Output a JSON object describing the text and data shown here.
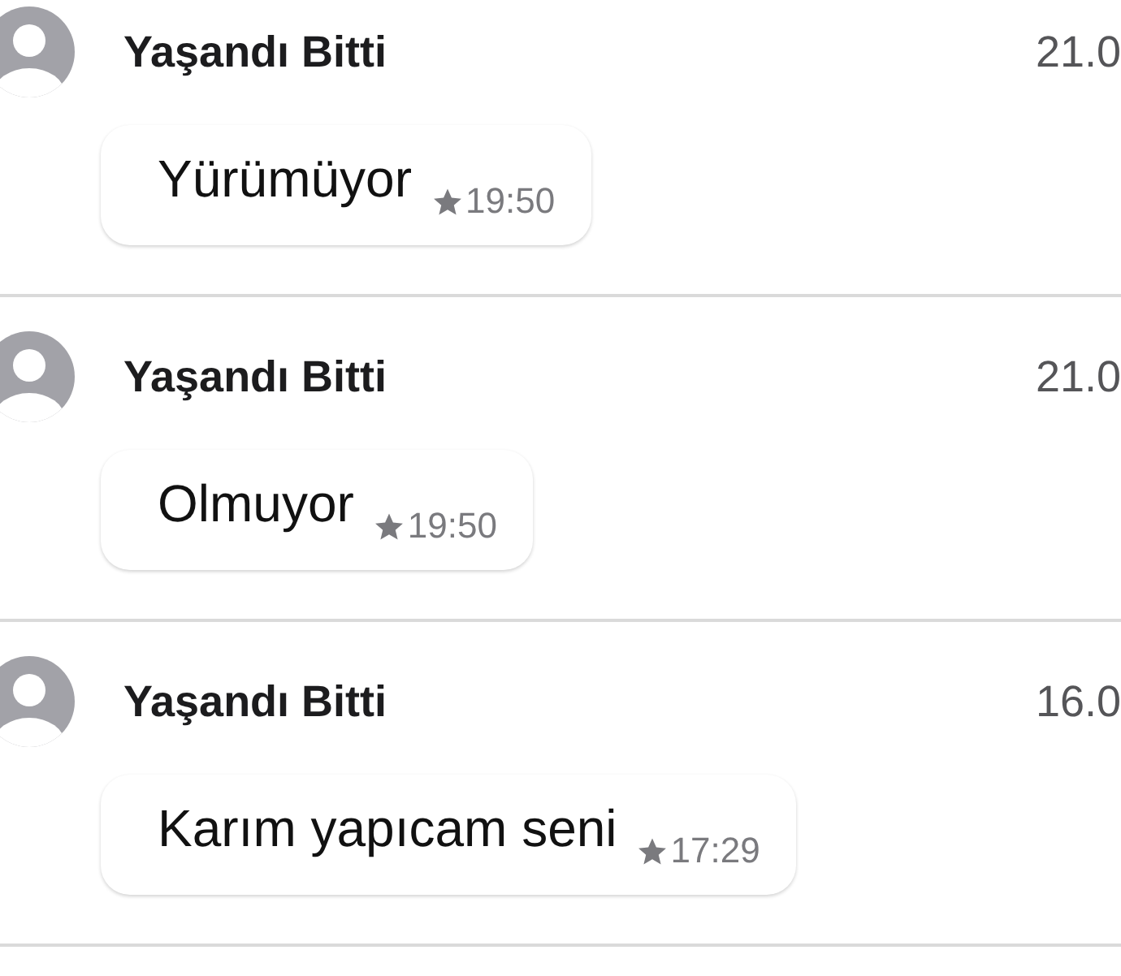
{
  "conversations": [
    {
      "sender": "Yaşandı Bitti",
      "date": "21.0",
      "message": {
        "text": "Yürümüyor",
        "starred": true,
        "time": "19:50"
      }
    },
    {
      "sender": "Yaşandı Bitti",
      "date": "21.0",
      "message": {
        "text": "Olmuyor",
        "starred": true,
        "time": "19:50"
      }
    },
    {
      "sender": "Yaşandı Bitti",
      "date": "16.0",
      "message": {
        "text": "Karım yapıcam seni",
        "starred": true,
        "time": "17:29"
      }
    }
  ]
}
